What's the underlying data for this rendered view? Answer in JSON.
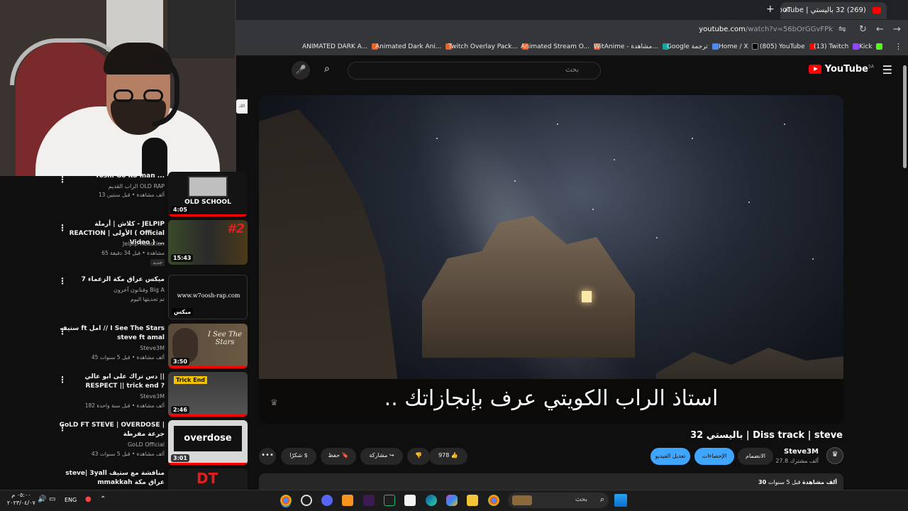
{
  "browser": {
    "tab_title": "(269) 32 باليستي | YouTube - ...",
    "new_tab": "+",
    "close_tab": "×",
    "url_host": "youtube.com",
    "url_path": "/watch?v=56bOrGGvFPk",
    "bookmarks": [
      {
        "label": "ANIMATED DARK A...",
        "color": "#e8622a"
      },
      {
        "label": "Animated Dark Ani...",
        "color": "#e8622a"
      },
      {
        "label": "Twitch Overlay Pack...",
        "color": "#e8622a"
      },
      {
        "label": "Animated Stream O...",
        "color": "#e8622a"
      },
      {
        "label": "WitAnime - مشاهدة...",
        "color": "#1aa39f"
      },
      {
        "label": "Google ترجمة",
        "color": "#4c8bf5"
      },
      {
        "label": "Home / X",
        "color": "#000000"
      },
      {
        "label": "(805) YouTube",
        "color": "#ff0000"
      },
      {
        "label": "(13) Twitch",
        "color": "#9146ff"
      },
      {
        "label": "Kick",
        "color": "#53fc18"
      }
    ]
  },
  "youtube": {
    "logo": "YouTube",
    "region": "SA",
    "search_placeholder": "بحث"
  },
  "sidebar_tip": "الك",
  "recommendations": [
    {
      "title": "Yoshi Go Ko man ...",
      "channel": "الراب القديم OLD RAP",
      "meta": "13 ألف مشاهدة • قبل سنتين",
      "duration": "4:05",
      "thumb_text": "OLD SCHOOL",
      "progress": 1.0,
      "badge": ""
    },
    {
      "title": "كلاش | أرملة - JELPIP REACTION | الأولى ( Official Video ) ...",
      "channel": "Jelpip Reaction",
      "meta": "65 مشاهدة • قبل 34 دقيقة",
      "duration": "15:43",
      "thumb_text": "#2",
      "progress": 0,
      "badge": "جديد"
    },
    {
      "title": "ميكس عراق مكة الزعماء 7",
      "channel": "وفنانون آخرون Big A",
      "meta": "تم تحديثها اليوم",
      "duration": "ميكس",
      "thumb_text": "www.w7oosh-rap.com",
      "progress": 0,
      "badge": ""
    },
    {
      "title": "ستيف ft امل // I See The Stars steve ft amal",
      "channel": "Steve3M",
      "meta": "45 ألف مشاهدة • قبل 5 سنوات",
      "duration": "3:50",
      "thumb_text": "I See The Stars",
      "progress": 1.0,
      "badge": ""
    },
    {
      "title": "دس تراك على ابو عالي || RESPECT || trick end ?",
      "channel": "Steve3M",
      "meta": "182 ألف مشاهدة • قبل سنة واحدة",
      "duration": "2:46",
      "thumb_text": "Trick End",
      "progress": 1.0,
      "badge": ""
    },
    {
      "title": "GoLD FT STEVE | OVERDOSE | جرعة مفرطة",
      "channel": "GoLD Official",
      "meta": "43 ألف مشاهدة • قبل 5 سنوات",
      "duration": "3:01",
      "thumb_text": "overdose",
      "progress": 1.0,
      "badge": ""
    },
    {
      "title": "steve| 3yall مناقشة مع ستيف mmakkah عراق مكة",
      "channel": "",
      "meta": "",
      "duration": "",
      "thumb_text": "DT",
      "progress": 0,
      "badge": ""
    }
  ],
  "video": {
    "subtitle": "استاذ الراب الكويتي عرف بإنجازاتك ..",
    "title": "32 باليستي | Diss track | steve",
    "channel_name": "Steve3M",
    "subscribers": "27.8 ألف مشترك",
    "join": "الانضمام",
    "stats": "الإحصاءات",
    "edit": "تعديل الفيديو",
    "likes": "978",
    "share": "مشاركة",
    "save": "حفظ",
    "thanks": "شكرًا",
    "more": "•••",
    "views": "30 ألف مشاهدة",
    "age": "قبل 5 سنوات"
  },
  "taskbar": {
    "search": "بحث",
    "lang": "ENG",
    "time": "٠٥:٠٠ م",
    "date": "٢٠٢٣/٠٤/٠٧"
  }
}
